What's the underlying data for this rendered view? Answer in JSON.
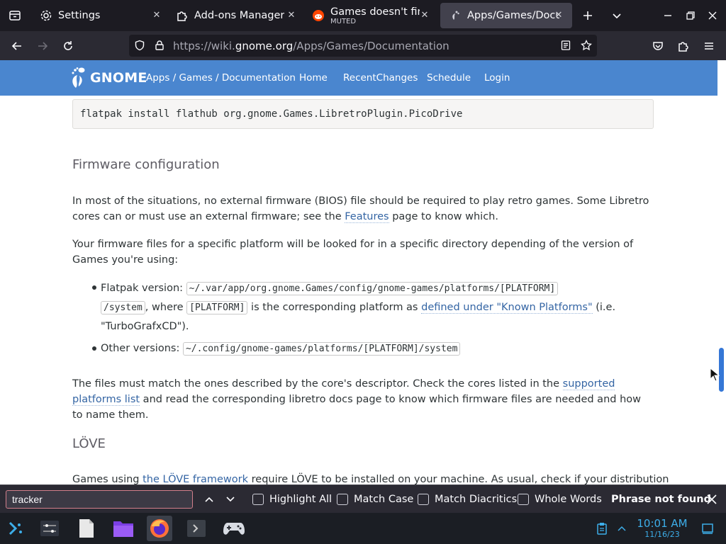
{
  "browser": {
    "tabs": [
      {
        "title": "Settings",
        "icon": "gear-icon"
      },
      {
        "title": "Add-ons Manager",
        "icon": "puzzle-icon"
      },
      {
        "title": "Games doesn't find",
        "subtitle": "MUTED",
        "icon": "reddit-icon"
      },
      {
        "title": "Apps/Games/Docum",
        "icon": "gnome-foot-icon",
        "active": true
      }
    ],
    "url_prefix": "https://wiki.",
    "url_domain": "gnome.org",
    "url_path": "/Apps/Games/Documentation"
  },
  "site": {
    "logo_text": "GNOME",
    "breadcrumb": "Apps / Games / Documentation",
    "nav": [
      "Home",
      "RecentChanges",
      "Schedule",
      "Login"
    ]
  },
  "article": {
    "code_install": "flatpak install flathub org.gnome.Games.LibretroPlugin.PicoDrive",
    "h_firmware": "Firmware configuration",
    "p1_a": "In most of the situations, no external firmware (BIOS) file should be required to play retro games. Some Libretro cores can or must use an external firmware; see the ",
    "p1_link": "Features",
    "p1_b": " page to know which.",
    "p2": "Your firmware files for a specific platform will be looked for in a specific directory depending of the version of Games you're using:",
    "li1_label": "Flatpak version: ",
    "li1_code1": "~/.var/app/org.gnome.Games/config/gnome-games/platforms/[PLATFORM]",
    "li1_code1b": "/system",
    "li1_where": ", where ",
    "li1_code2": "[PLATFORM]",
    "li1_mid": " is the corresponding platform as ",
    "li1_link": "defined under \"Known Platforms\"",
    "li1_end": " (i.e.",
    "li1_end2": "\"TurboGrafxCD\").",
    "li2_label": "Other versions: ",
    "li2_code": "~/.config/gnome-games/platforms/[PLATFORM]/system",
    "p3_a": "The files must match the ones described by the core's descriptor. Check the cores listed in the ",
    "p3_link": "supported platforms list",
    "p3_b": " and read the corresponding libretro docs page to know which firmware files are needed and how to name them.",
    "h_love": "LÖVE",
    "p4_a": "Games using ",
    "p4_link": "the LÖVE framework",
    "p4_b": " require LÖVE to be installed on your machine. As usual, check if your distribution"
  },
  "findbar": {
    "query": "tracker",
    "options": [
      "Highlight All",
      "Match Case",
      "Match Diacritics",
      "Whole Words"
    ],
    "status": "Phrase not found"
  },
  "taskbar": {
    "time": "10:01 AM",
    "date": "11/16/23"
  },
  "colors": {
    "gnome_header": "#4a86cf",
    "link": "#3465a4",
    "accent": "#3daee9"
  }
}
